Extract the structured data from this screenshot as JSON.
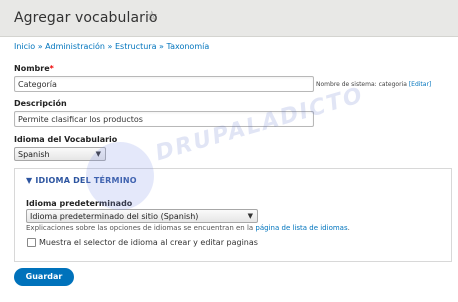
{
  "header": {
    "title": "Agregar vocabulario",
    "star": "☆"
  },
  "breadcrumb": {
    "items": [
      "Inicio",
      "Administración",
      "Estructura",
      "Taxonomía"
    ],
    "separator": "»"
  },
  "form": {
    "name": {
      "label": "Nombre",
      "required_mark": "*",
      "value": "Categoría"
    },
    "machine_name": {
      "prefix": "Nombre de sistema: categoria",
      "edit_link": "[Editar]"
    },
    "description": {
      "label": "Descripción",
      "value": "Permite clasificar los productos"
    },
    "vocab_language": {
      "label": "Idioma del Vocabulario",
      "selected": "Spanish"
    },
    "term_language": {
      "summary": "▼ IDIOMA DEL TÉRMINO",
      "default_label": "Idioma predeterminado",
      "default_selected": "Idioma predeterminado del sitio (Spanish)",
      "help_text": "Explicaciones sobre las opciones de idiomas se encuentran en la",
      "help_link": "página de lista de idiomas",
      "help_end": ".",
      "checkbox_label": "Muestra el selector de idioma al crear y editar paginas"
    },
    "save_label": "Guardar"
  },
  "watermark": {
    "text": "DRUPALADICTO"
  },
  "colors": {
    "accent": "#0072bb",
    "link": "#0074bd",
    "header_bg": "#e8e8e6"
  }
}
